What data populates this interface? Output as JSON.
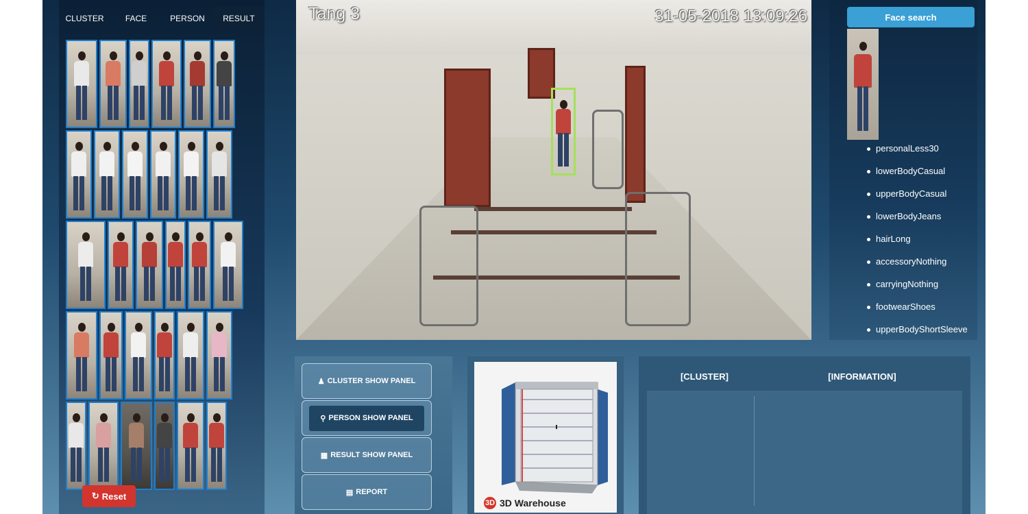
{
  "left_panel": {
    "tabs": [
      {
        "label": "CLUSTER"
      },
      {
        "label": "FACE"
      },
      {
        "label": "PERSON"
      },
      {
        "label": "RESULT",
        "active": true
      }
    ],
    "reset_label": "Reset"
  },
  "camera": {
    "location_label": "Tang 3",
    "timestamp": "31-05-2018 13:09:26",
    "detection_color": "#a5e05a"
  },
  "face_panel": {
    "search_button": "Face search",
    "attributes": [
      "personalLess30",
      "lowerBodyCasual",
      "upperBodyCasual",
      "lowerBodyJeans",
      "hairLong",
      "accessoryNothing",
      "carryingNothing",
      "footwearShoes",
      "upperBodyShortSleeve"
    ]
  },
  "controls": {
    "buttons": [
      {
        "label": "CLUSTER SHOW PANEL",
        "icon": "user-icon"
      },
      {
        "label": "PERSON SHOW PANEL",
        "icon": "person-icon"
      },
      {
        "label": "RESULT SHOW PANEL",
        "icon": "table-icon"
      },
      {
        "label": "REPORT",
        "icon": "report-icon"
      }
    ]
  },
  "warehouse": {
    "logo_text": "3D Warehouse"
  },
  "info_table": {
    "columns": [
      "[CLUSTER]",
      "[INFORMATION]"
    ]
  },
  "colors": {
    "accent": "#3aa0d5",
    "reset": "#d2352e",
    "thumb_border": "#1b7fd1"
  }
}
